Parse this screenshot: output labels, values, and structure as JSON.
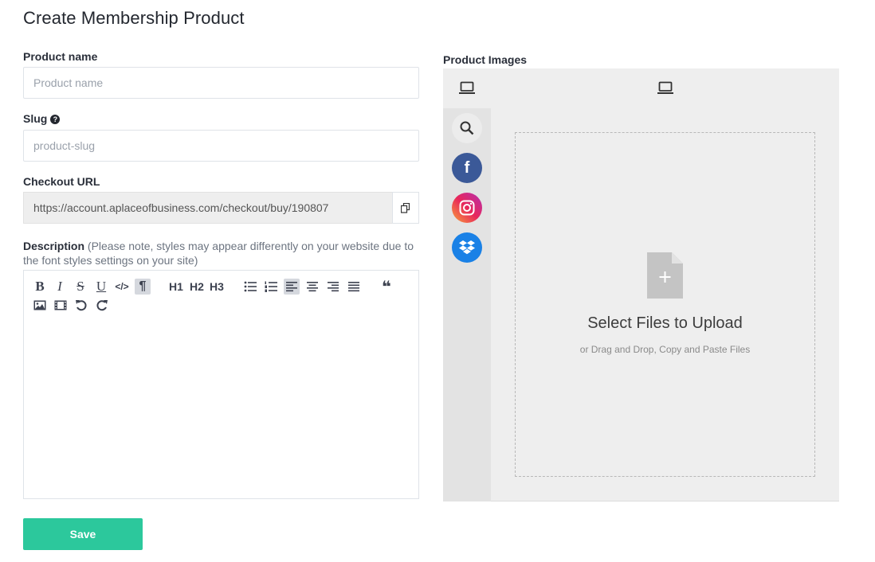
{
  "page": {
    "title": "Create Membership Product"
  },
  "form": {
    "product_name": {
      "label": "Product name",
      "placeholder": "Product name",
      "value": ""
    },
    "slug": {
      "label": "Slug",
      "help_icon": "?",
      "placeholder": "product-slug",
      "value": ""
    },
    "checkout_url": {
      "label": "Checkout URL",
      "value": "https://account.aplaceofbusiness.com/checkout/buy/190807",
      "copy_icon": "copy-icon"
    },
    "description": {
      "label": "Description",
      "note": "(Please note, styles may appear differently on your website due to the font styles settings on your site)",
      "toolbar": {
        "bold": "B",
        "italic": "I",
        "strike": "S",
        "underline": "U",
        "code": "</>",
        "paragraph": "¶",
        "h1": "H1",
        "h2": "H2",
        "h3": "H3",
        "quote": "❝"
      }
    },
    "save_label": "Save"
  },
  "images": {
    "label": "Product Images",
    "sources": [
      "laptop-icon",
      "search-icon",
      "facebook-icon",
      "instagram-icon",
      "dropbox-icon"
    ],
    "drop_title": "Select Files to Upload",
    "drop_subtitle": "or Drag and Drop, Copy and Paste Files"
  },
  "colors": {
    "accent": "#2cc89c",
    "facebook": "#3b5998",
    "dropbox": "#1a81e6"
  }
}
